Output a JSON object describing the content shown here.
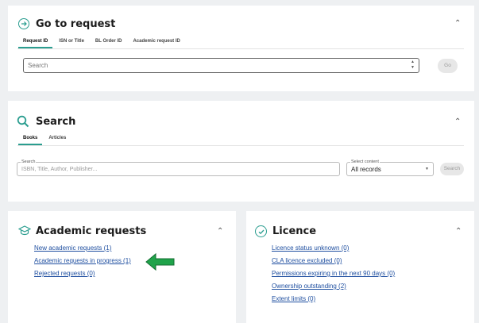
{
  "go_to_request": {
    "title": "Go to request",
    "tabs": [
      "Request ID",
      "ISN or Title",
      "BL Order ID",
      "Academic request ID"
    ],
    "search_placeholder": "Search",
    "go_label": "Go"
  },
  "search": {
    "title": "Search",
    "tabs": [
      "Books",
      "Articles"
    ],
    "search_label": "Search",
    "search_placeholder": "ISBN, Title, Author, Publisher...",
    "select_label": "Select content",
    "select_value": "All records",
    "search_button": "Search"
  },
  "academic": {
    "title": "Academic requests",
    "links": [
      "New academic requests (1)",
      "Academic requests in progress (1)",
      "Rejected requests (0)"
    ]
  },
  "licence": {
    "title": "Licence",
    "links": [
      "Licence status unknown (0)",
      "CLA licence excluded (0)",
      "Permissions expiring in the next 90 days (0)",
      "Ownership outstanding (2)",
      "Extent limits (0)"
    ]
  },
  "colors": {
    "accent": "#2a9d8f",
    "link": "#1f4fa0",
    "arrow": "#1fa34a"
  }
}
